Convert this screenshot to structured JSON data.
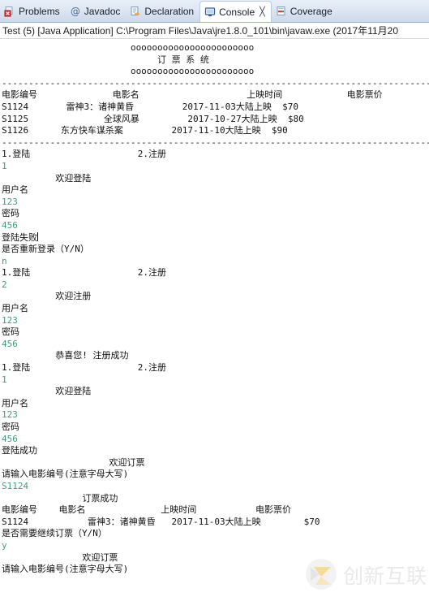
{
  "tabs": [
    {
      "label": "Problems",
      "icon": "problems-icon",
      "active": false,
      "closable": false
    },
    {
      "label": "Javadoc",
      "icon": "javadoc-at-icon",
      "active": false,
      "closable": false
    },
    {
      "label": "Declaration",
      "icon": "declaration-icon",
      "active": false,
      "closable": false
    },
    {
      "label": "Console",
      "icon": "console-icon",
      "active": true,
      "closable": true,
      "close_glyph": "╳"
    },
    {
      "label": "Coverage",
      "icon": "coverage-icon",
      "active": false,
      "closable": false
    }
  ],
  "status": {
    "text": "Test (5) [Java Application] C:\\Program Files\\Java\\jre1.8.0_101\\bin\\javaw.exe (2017年11月20"
  },
  "colors": {
    "stdout": "#111111",
    "stdin": "#3f9e7e",
    "tabbar_top": "#e8eef7",
    "tabbar_bottom": "#ccd9ec",
    "active_tab": "#ffffff"
  },
  "watermark": {
    "text": "创新互联",
    "logo": "circle-x-logo"
  },
  "console": {
    "lines": [
      {
        "t": "banner",
        "text": "                        ooooooooooooooooooooooo"
      },
      {
        "t": "banner",
        "text": "                             订 票 系 统"
      },
      {
        "t": "banner",
        "text": "                        ooooooooooooooooooooooo"
      },
      {
        "t": "out",
        "text": ""
      },
      {
        "t": "rule",
        "text": "-----------------------------------------------------------------------------------------"
      },
      {
        "t": "out",
        "text": "电影编号              电影名                    上映时间            电影票价"
      },
      {
        "t": "out",
        "text": "S1124       雷神3：诸神黄昏         2017-11-03大陆上映  $70"
      },
      {
        "t": "out",
        "text": "S1125              全球风暴         2017-10-27大陆上映  $80"
      },
      {
        "t": "out",
        "text": "S1126      东方快车谋杀案         2017-11-10大陆上映  $90"
      },
      {
        "t": "rule",
        "text": "-----------------------------------------------------------------------------------------"
      },
      {
        "t": "out",
        "text": "1.登陆                    2.注册"
      },
      {
        "t": "in",
        "text": "1"
      },
      {
        "t": "out",
        "text": ""
      },
      {
        "t": "out",
        "text": "          欢迎登陆"
      },
      {
        "t": "out",
        "text": ""
      },
      {
        "t": "out",
        "text": "用户名"
      },
      {
        "t": "in",
        "text": "123"
      },
      {
        "t": "out",
        "text": "密码"
      },
      {
        "t": "in",
        "text": "456"
      },
      {
        "t": "out",
        "text": ""
      },
      {
        "t": "out",
        "text": "登陆失败",
        "caret": true
      },
      {
        "t": "out",
        "text": "是否重新登录（Y/N）"
      },
      {
        "t": "in",
        "text": "n"
      },
      {
        "t": "out",
        "text": "1.登陆                    2.注册"
      },
      {
        "t": "in",
        "text": "2"
      },
      {
        "t": "out",
        "text": ""
      },
      {
        "t": "out",
        "text": "          欢迎注册"
      },
      {
        "t": "out",
        "text": ""
      },
      {
        "t": "out",
        "text": "用户名"
      },
      {
        "t": "in",
        "text": "123"
      },
      {
        "t": "out",
        "text": "密码"
      },
      {
        "t": "in",
        "text": "456"
      },
      {
        "t": "out",
        "text": ""
      },
      {
        "t": "out",
        "text": "          恭喜您! 注册成功"
      },
      {
        "t": "out",
        "text": "1.登陆                    2.注册"
      },
      {
        "t": "in",
        "text": "1"
      },
      {
        "t": "out",
        "text": ""
      },
      {
        "t": "out",
        "text": "          欢迎登陆"
      },
      {
        "t": "out",
        "text": ""
      },
      {
        "t": "out",
        "text": "用户名"
      },
      {
        "t": "in",
        "text": "123"
      },
      {
        "t": "out",
        "text": "密码"
      },
      {
        "t": "in",
        "text": "456"
      },
      {
        "t": "out",
        "text": "登陆成功"
      },
      {
        "t": "out",
        "text": ""
      },
      {
        "t": "out",
        "text": "                    欢迎订票"
      },
      {
        "t": "out",
        "text": "请输入电影编号(注意字母大写)"
      },
      {
        "t": "in",
        "text": "S1124"
      },
      {
        "t": "out",
        "text": ""
      },
      {
        "t": "out",
        "text": "               订票成功"
      },
      {
        "t": "out",
        "text": "电影编号    电影名              上映时间           电影票价"
      },
      {
        "t": "out",
        "text": "S1124           雷神3：诸神黄昏   2017-11-03大陆上映        $70"
      },
      {
        "t": "out",
        "text": "是否需要继续订票（Y/N）"
      },
      {
        "t": "in",
        "text": "y"
      },
      {
        "t": "out",
        "text": ""
      },
      {
        "t": "out",
        "text": "               欢迎订票"
      },
      {
        "t": "out",
        "text": "请输入电影编号(注意字母大写)"
      }
    ]
  }
}
